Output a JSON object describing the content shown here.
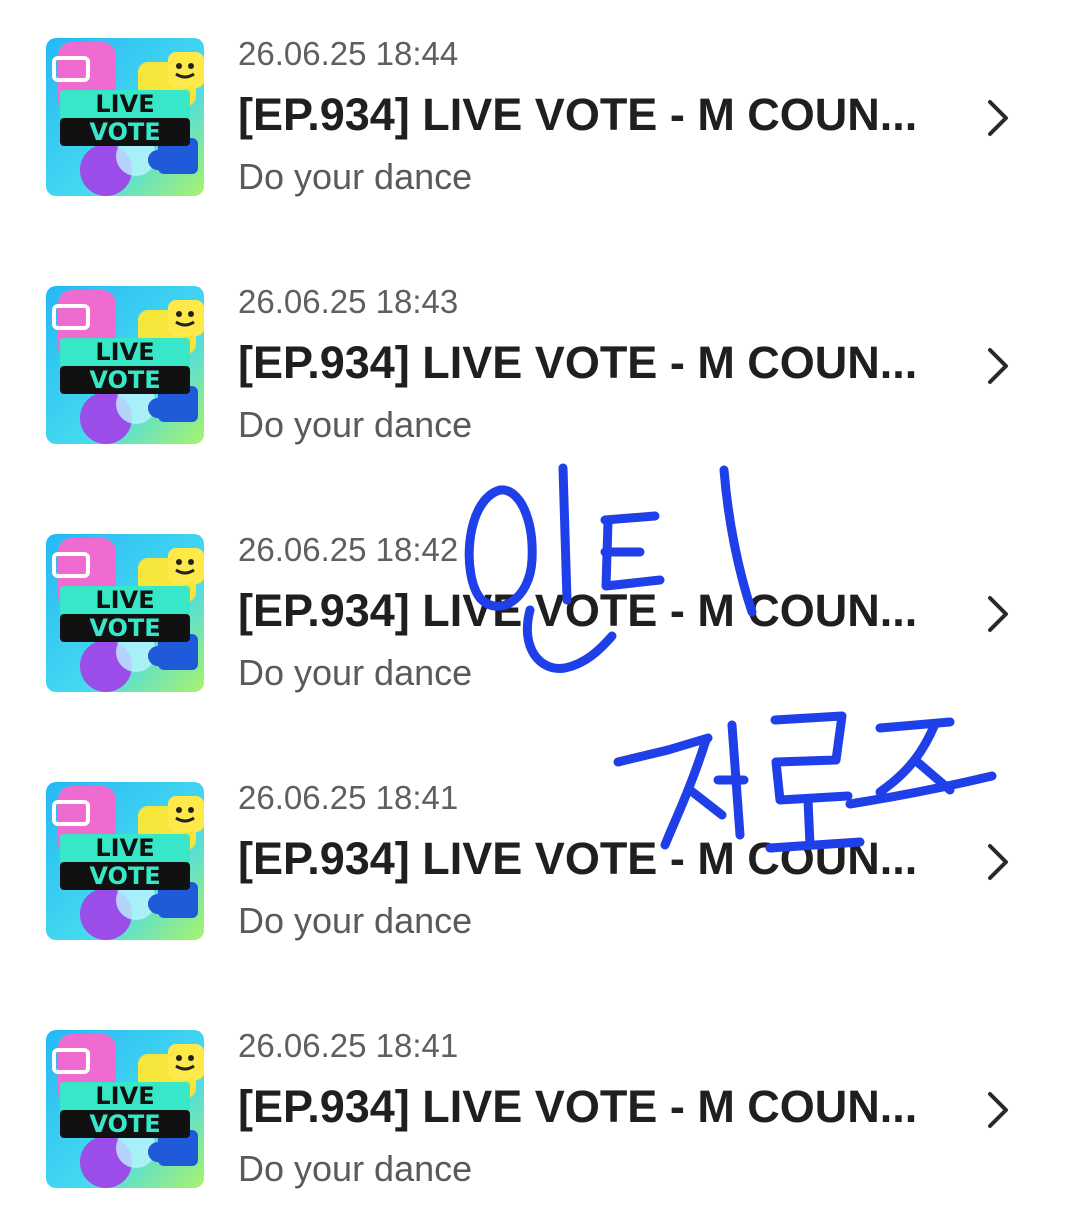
{
  "notifications": [
    {
      "time": "26.06.25 18:44",
      "title": "[EP.934] LIVE VOTE - M COUN...",
      "subtitle": "Do your dance"
    },
    {
      "time": "26.06.25 18:43",
      "title": "[EP.934] LIVE VOTE - M COUN...",
      "subtitle": "Do your dance"
    },
    {
      "time": "26.06.25 18:42",
      "title": "[EP.934] LIVE VOTE - M COUN...",
      "subtitle": "Do your dance"
    },
    {
      "time": "26.06.25 18:41",
      "title": "[EP.934] LIVE VOTE - M COUN...",
      "subtitle": "Do your dance"
    },
    {
      "time": "26.06.25 18:41",
      "title": "[EP.934] LIVE VOTE - M COUN...",
      "subtitle": "Do your dance"
    }
  ],
  "thumbnail_text": {
    "line1": "LIVE",
    "line2": "VOTE"
  },
  "handwriting": {
    "line1": "인티",
    "line2": "저리즈",
    "color": "#1f3fe8"
  },
  "colors": {
    "timestamp": "#5f5f5f",
    "title": "#1f1f1f",
    "subtitle": "#5a5a5a",
    "chevron": "#2a2a2a",
    "thumb_bg": "#3fd0f0",
    "thumb_band": "#38e6c8"
  },
  "icons": {
    "chevron": "chevron-right-icon",
    "thumbnail": "live-vote-thumbnail"
  }
}
